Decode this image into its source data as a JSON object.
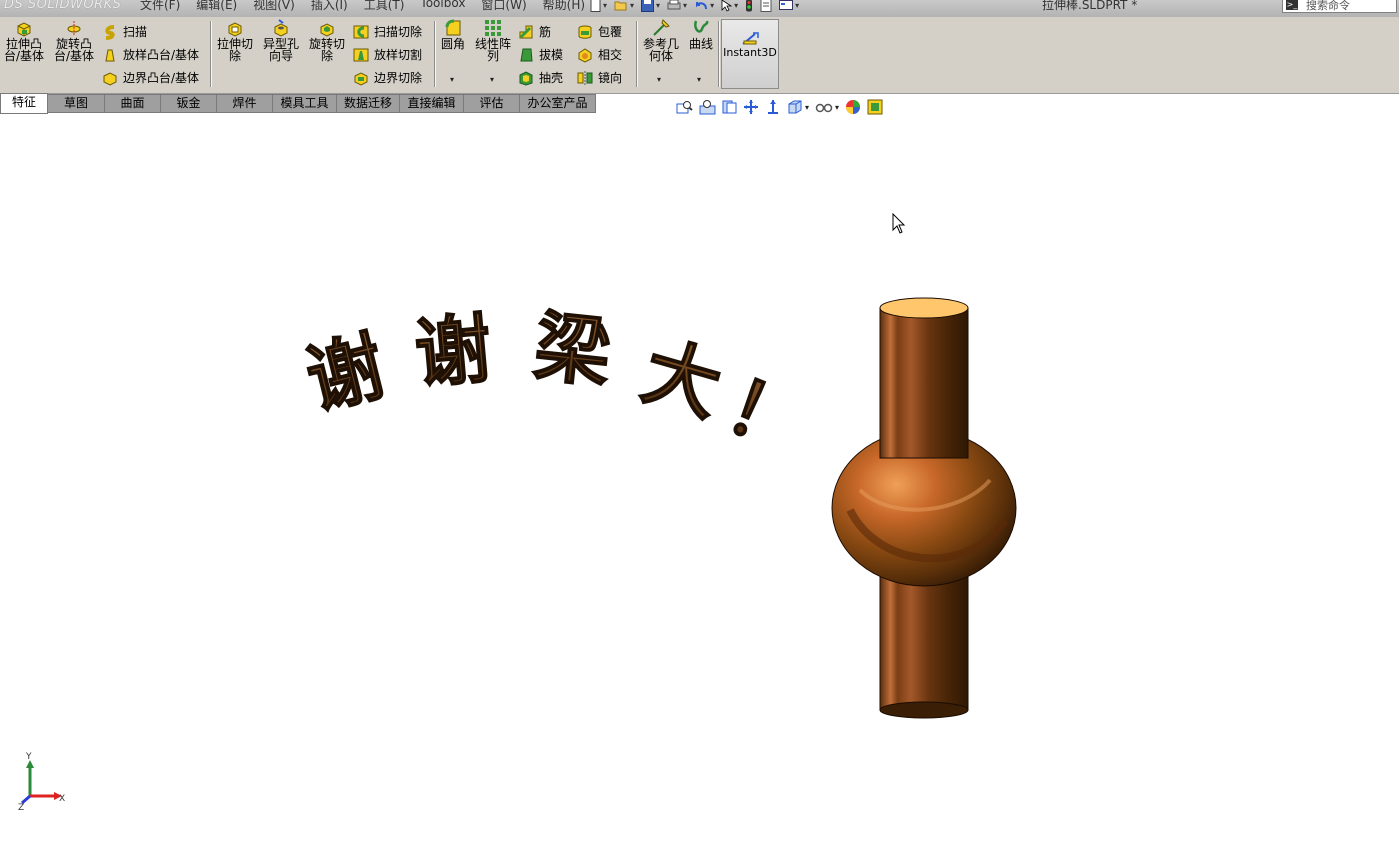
{
  "app": {
    "logo_text": "DS SOLIDWORKS"
  },
  "menu": [
    "文件(F)",
    "编辑(E)",
    "视图(V)",
    "插入(I)",
    "工具(T)",
    "Toolbox",
    "窗口(W)",
    "帮助(H)"
  ],
  "document_title": "拉伸棒.SLDPRT *",
  "search": {
    "placeholder": "搜索命令"
  },
  "ribbon": {
    "extrude_boss": "拉伸凸\n台/基体",
    "revolve_boss": "旋转凸\n台/基体",
    "sweep": "扫描",
    "loft_boss": "放样凸台/基体",
    "boundary_boss": "边界凸台/基体",
    "extrude_cut": "拉伸切\n除",
    "hole_wizard": "异型孔\n向导",
    "revolve_cut": "旋转切\n除",
    "swept_cut": "扫描切除",
    "lofted_cut": "放样切割",
    "boundary_cut": "边界切除",
    "fillet": "圆角",
    "linear_pattern": "线性阵\n列",
    "rib": "筋",
    "draft": "拔模",
    "shell": "抽壳",
    "wrap": "包覆",
    "intersect": "相交",
    "mirror": "镜向",
    "ref_geometry": "参考几\n何体",
    "curves": "曲线",
    "instant3d": "Instant3D"
  },
  "tabs": [
    {
      "label": "特征",
      "active": true
    },
    {
      "label": "草图"
    },
    {
      "label": "曲面"
    },
    {
      "label": "钣金"
    },
    {
      "label": "焊件"
    },
    {
      "label": "模具工具"
    },
    {
      "label": "数据迁移"
    },
    {
      "label": "直接编辑"
    },
    {
      "label": "评估"
    },
    {
      "label": "办公室产品"
    }
  ],
  "viewport": {
    "greeting_text": "谢谢梁大！",
    "greeting_chars": [
      "谢",
      "谢",
      "梁",
      "大",
      "！"
    ],
    "triad": {
      "x": "X",
      "y": "Y",
      "z": "Z"
    }
  },
  "colors": {
    "ribbon_bg": "#d4d0c8",
    "tab_inactive": "#9f9f9f",
    "text_brown": "#5a3510",
    "model_copper": "#8a4a1e",
    "model_top_face": "#ffc66b"
  }
}
